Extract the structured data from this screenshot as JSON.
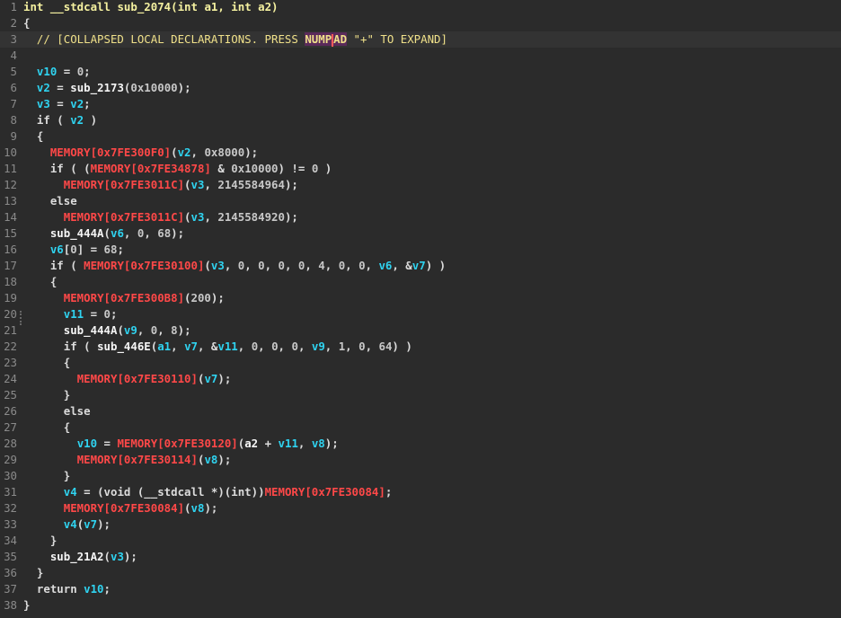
{
  "editor": {
    "lines": [
      {
        "n": "1",
        "tokens": [
          [
            "kw",
            "int "
          ],
          [
            "fn",
            "__stdcall sub_2074"
          ],
          [
            "kw",
            "("
          ],
          [
            "kw",
            "int "
          ],
          [
            "fn",
            "a1"
          ],
          [
            "kw",
            ", "
          ],
          [
            "kw",
            "int "
          ],
          [
            "fn",
            "a2"
          ],
          [
            "kw",
            ")"
          ]
        ],
        "header": true
      },
      {
        "n": "2",
        "tokens": [
          [
            "kw",
            "{"
          ]
        ]
      },
      {
        "n": "3",
        "tokens": [
          [
            "cm",
            "  // [COLLAPSED LOCAL DECLARATIONS. PRESS "
          ],
          [
            "hl",
            "NUMPAD"
          ],
          [
            "cm",
            " \"+\" TO EXPAND]"
          ]
        ],
        "current": true
      },
      {
        "n": "4",
        "tokens": []
      },
      {
        "n": "5",
        "tokens": [
          [
            "kw",
            "  "
          ],
          [
            "var",
            "v10"
          ],
          [
            "kw",
            " = "
          ],
          [
            "num",
            "0"
          ],
          [
            "kw",
            ";"
          ]
        ]
      },
      {
        "n": "6",
        "tokens": [
          [
            "kw",
            "  "
          ],
          [
            "var",
            "v2"
          ],
          [
            "kw",
            " = "
          ],
          [
            "fn",
            "sub_2173"
          ],
          [
            "kw",
            "("
          ],
          [
            "num",
            "0x10000"
          ],
          [
            "kw",
            ");"
          ]
        ]
      },
      {
        "n": "7",
        "tokens": [
          [
            "kw",
            "  "
          ],
          [
            "var",
            "v3"
          ],
          [
            "kw",
            " = "
          ],
          [
            "var",
            "v2"
          ],
          [
            "kw",
            ";"
          ]
        ]
      },
      {
        "n": "8",
        "tokens": [
          [
            "kw",
            "  if ( "
          ],
          [
            "var",
            "v2"
          ],
          [
            "kw",
            " )"
          ]
        ]
      },
      {
        "n": "9",
        "tokens": [
          [
            "kw",
            "  {"
          ]
        ]
      },
      {
        "n": "10",
        "tokens": [
          [
            "kw",
            "    "
          ],
          [
            "mem",
            "MEMORY[0x7FE300F0]"
          ],
          [
            "kw",
            "("
          ],
          [
            "var",
            "v2"
          ],
          [
            "kw",
            ", "
          ],
          [
            "num",
            "0x8000"
          ],
          [
            "kw",
            ");"
          ]
        ]
      },
      {
        "n": "11",
        "tokens": [
          [
            "kw",
            "    if ( ("
          ],
          [
            "mem",
            "MEMORY[0x7FE34878]"
          ],
          [
            "kw",
            " & "
          ],
          [
            "num",
            "0x10000"
          ],
          [
            "kw",
            ") != "
          ],
          [
            "num",
            "0"
          ],
          [
            "kw",
            " )"
          ]
        ]
      },
      {
        "n": "12",
        "tokens": [
          [
            "kw",
            "      "
          ],
          [
            "mem",
            "MEMORY[0x7FE3011C]"
          ],
          [
            "kw",
            "("
          ],
          [
            "var",
            "v3"
          ],
          [
            "kw",
            ", "
          ],
          [
            "num",
            "2145584964"
          ],
          [
            "kw",
            ");"
          ]
        ]
      },
      {
        "n": "13",
        "tokens": [
          [
            "kw",
            "    else"
          ]
        ]
      },
      {
        "n": "14",
        "tokens": [
          [
            "kw",
            "      "
          ],
          [
            "mem",
            "MEMORY[0x7FE3011C]"
          ],
          [
            "kw",
            "("
          ],
          [
            "var",
            "v3"
          ],
          [
            "kw",
            ", "
          ],
          [
            "num",
            "2145584920"
          ],
          [
            "kw",
            ");"
          ]
        ]
      },
      {
        "n": "15",
        "tokens": [
          [
            "kw",
            "    "
          ],
          [
            "fn",
            "sub_444A"
          ],
          [
            "kw",
            "("
          ],
          [
            "var",
            "v6"
          ],
          [
            "kw",
            ", "
          ],
          [
            "num",
            "0"
          ],
          [
            "kw",
            ", "
          ],
          [
            "num",
            "68"
          ],
          [
            "kw",
            ");"
          ]
        ]
      },
      {
        "n": "16",
        "tokens": [
          [
            "kw",
            "    "
          ],
          [
            "var",
            "v6"
          ],
          [
            "kw",
            "["
          ],
          [
            "num",
            "0"
          ],
          [
            "kw",
            "] = "
          ],
          [
            "num",
            "68"
          ],
          [
            "kw",
            ";"
          ]
        ]
      },
      {
        "n": "17",
        "tokens": [
          [
            "kw",
            "    if ( "
          ],
          [
            "mem",
            "MEMORY[0x7FE30100]"
          ],
          [
            "kw",
            "("
          ],
          [
            "var",
            "v3"
          ],
          [
            "kw",
            ", "
          ],
          [
            "num",
            "0"
          ],
          [
            "kw",
            ", "
          ],
          [
            "num",
            "0"
          ],
          [
            "kw",
            ", "
          ],
          [
            "num",
            "0"
          ],
          [
            "kw",
            ", "
          ],
          [
            "num",
            "0"
          ],
          [
            "kw",
            ", "
          ],
          [
            "num",
            "4"
          ],
          [
            "kw",
            ", "
          ],
          [
            "num",
            "0"
          ],
          [
            "kw",
            ", "
          ],
          [
            "num",
            "0"
          ],
          [
            "kw",
            ", "
          ],
          [
            "var",
            "v6"
          ],
          [
            "kw",
            ", &"
          ],
          [
            "var",
            "v7"
          ],
          [
            "kw",
            ") )"
          ]
        ]
      },
      {
        "n": "18",
        "tokens": [
          [
            "kw",
            "    {"
          ]
        ]
      },
      {
        "n": "19",
        "tokens": [
          [
            "kw",
            "      "
          ],
          [
            "mem",
            "MEMORY[0x7FE300B8]"
          ],
          [
            "kw",
            "("
          ],
          [
            "num",
            "200"
          ],
          [
            "kw",
            ");"
          ]
        ]
      },
      {
        "n": "20",
        "tokens": [
          [
            "kw",
            "      "
          ],
          [
            "var",
            "v11"
          ],
          [
            "kw",
            " = "
          ],
          [
            "num",
            "0"
          ],
          [
            "kw",
            ";"
          ]
        ]
      },
      {
        "n": "21",
        "tokens": [
          [
            "kw",
            "      "
          ],
          [
            "fn",
            "sub_444A"
          ],
          [
            "kw",
            "("
          ],
          [
            "var",
            "v9"
          ],
          [
            "kw",
            ", "
          ],
          [
            "num",
            "0"
          ],
          [
            "kw",
            ", "
          ],
          [
            "num",
            "8"
          ],
          [
            "kw",
            ");"
          ]
        ]
      },
      {
        "n": "22",
        "tokens": [
          [
            "kw",
            "      if ( "
          ],
          [
            "fn",
            "sub_446E"
          ],
          [
            "kw",
            "("
          ],
          [
            "var",
            "a1"
          ],
          [
            "kw",
            ", "
          ],
          [
            "var",
            "v7"
          ],
          [
            "kw",
            ", &"
          ],
          [
            "var",
            "v11"
          ],
          [
            "kw",
            ", "
          ],
          [
            "num",
            "0"
          ],
          [
            "kw",
            ", "
          ],
          [
            "num",
            "0"
          ],
          [
            "kw",
            ", "
          ],
          [
            "num",
            "0"
          ],
          [
            "kw",
            ", "
          ],
          [
            "var",
            "v9"
          ],
          [
            "kw",
            ", "
          ],
          [
            "num",
            "1"
          ],
          [
            "kw",
            ", "
          ],
          [
            "num",
            "0"
          ],
          [
            "kw",
            ", "
          ],
          [
            "num",
            "64"
          ],
          [
            "kw",
            ") )"
          ]
        ]
      },
      {
        "n": "23",
        "tokens": [
          [
            "kw",
            "      {"
          ]
        ]
      },
      {
        "n": "24",
        "tokens": [
          [
            "kw",
            "        "
          ],
          [
            "mem",
            "MEMORY[0x7FE30110]"
          ],
          [
            "kw",
            "("
          ],
          [
            "var",
            "v7"
          ],
          [
            "kw",
            ");"
          ]
        ]
      },
      {
        "n": "25",
        "tokens": [
          [
            "kw",
            "      }"
          ]
        ]
      },
      {
        "n": "26",
        "tokens": [
          [
            "kw",
            "      else"
          ]
        ]
      },
      {
        "n": "27",
        "tokens": [
          [
            "kw",
            "      {"
          ]
        ]
      },
      {
        "n": "28",
        "tokens": [
          [
            "kw",
            "        "
          ],
          [
            "var",
            "v10"
          ],
          [
            "kw",
            " = "
          ],
          [
            "mem",
            "MEMORY[0x7FE30120]"
          ],
          [
            "kw",
            "("
          ],
          [
            "fn",
            "a2"
          ],
          [
            "kw",
            " + "
          ],
          [
            "var",
            "v11"
          ],
          [
            "kw",
            ", "
          ],
          [
            "var",
            "v8"
          ],
          [
            "kw",
            ");"
          ]
        ]
      },
      {
        "n": "29",
        "tokens": [
          [
            "kw",
            "        "
          ],
          [
            "mem",
            "MEMORY[0x7FE30114]"
          ],
          [
            "kw",
            "("
          ],
          [
            "var",
            "v8"
          ],
          [
            "kw",
            ");"
          ]
        ]
      },
      {
        "n": "30",
        "tokens": [
          [
            "kw",
            "      }"
          ]
        ]
      },
      {
        "n": "31",
        "tokens": [
          [
            "kw",
            "      "
          ],
          [
            "var",
            "v4"
          ],
          [
            "kw",
            " = (void (__stdcall *)(int))"
          ],
          [
            "mem",
            "MEMORY[0x7FE30084]"
          ],
          [
            "kw",
            ";"
          ]
        ]
      },
      {
        "n": "32",
        "tokens": [
          [
            "kw",
            "      "
          ],
          [
            "mem",
            "MEMORY[0x7FE30084]"
          ],
          [
            "kw",
            "("
          ],
          [
            "var",
            "v8"
          ],
          [
            "kw",
            ");"
          ]
        ]
      },
      {
        "n": "33",
        "tokens": [
          [
            "kw",
            "      "
          ],
          [
            "var",
            "v4"
          ],
          [
            "kw",
            "("
          ],
          [
            "var",
            "v7"
          ],
          [
            "kw",
            ");"
          ]
        ]
      },
      {
        "n": "34",
        "tokens": [
          [
            "kw",
            "    }"
          ]
        ]
      },
      {
        "n": "35",
        "tokens": [
          [
            "kw",
            "    "
          ],
          [
            "fn",
            "sub_21A2"
          ],
          [
            "kw",
            "("
          ],
          [
            "var",
            "v3"
          ],
          [
            "kw",
            ");"
          ]
        ]
      },
      {
        "n": "36",
        "tokens": [
          [
            "kw",
            "  }"
          ]
        ]
      },
      {
        "n": "37",
        "tokens": [
          [
            "kw",
            "  return "
          ],
          [
            "var",
            "v10"
          ],
          [
            "kw",
            ";"
          ]
        ]
      },
      {
        "n": "38",
        "tokens": [
          [
            "kw",
            "}"
          ]
        ]
      }
    ]
  },
  "colors": {
    "background": "#2b2b2b",
    "current_line": "#333333",
    "variable": "#2fd3f0",
    "memory_ref": "#ff4848",
    "comment": "#f0e18a",
    "highlight_bg": "#5a2a5a"
  }
}
